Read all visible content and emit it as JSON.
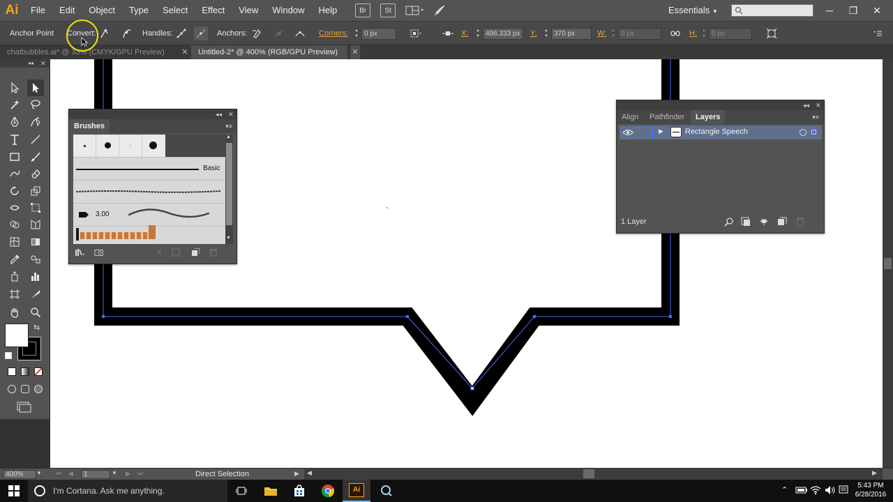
{
  "app": {
    "logo": "Ai"
  },
  "menu": [
    "File",
    "Edit",
    "Object",
    "Type",
    "Select",
    "Effect",
    "View",
    "Window",
    "Help"
  ],
  "menubar_buttons": {
    "bridge": "Br",
    "stock": "St"
  },
  "workspace": {
    "label": "Essentials"
  },
  "window_controls": {
    "minimize": "─",
    "restore": "❐",
    "close": "✕"
  },
  "controlbar": {
    "tool_label": "Anchor Point",
    "convert_label": "Convert:",
    "handles_label": "Handles:",
    "anchors_label": "Anchors:",
    "corners_label": "Corners:",
    "corners_value": "0 px",
    "x_label": "X:",
    "x_value": "496.333 px",
    "y_label": "Y:",
    "y_value": "370 px",
    "w_label": "W:",
    "w_value": "0 px",
    "h_label": "H:",
    "h_value": "0 px"
  },
  "tabs": [
    {
      "label": "chatbubbles.ai* @ 33% (CMYK/GPU Preview)",
      "active": false
    },
    {
      "label": "Untitled-2* @ 400% (RGB/GPU Preview)",
      "active": true
    }
  ],
  "tab_close": "✕",
  "brushes_panel": {
    "title": "Brushes",
    "basic_label": "Basic",
    "size_label": "3.00"
  },
  "layers_panel": {
    "tabs": [
      "Align",
      "Pathfinder",
      "Layers"
    ],
    "active_tab": "Layers",
    "layer_name": "Rectangle Speech",
    "count_label": "1 Layer"
  },
  "panel_controls": {
    "collapse": "◂◂",
    "close": "✕",
    "menu": "▾≡"
  },
  "statusbar": {
    "zoom": "400%",
    "page": "1",
    "tool": "Direct Selection"
  },
  "taskbar": {
    "cortana_placeholder": "I'm Cortana. Ask me anything.",
    "time": "5:43 PM",
    "date": "6/28/2016"
  },
  "colors": {
    "menubar": "#535353",
    "ai_orange": "#f7a21b",
    "path_blue": "#4a6cf0",
    "highlight_yellow": "#f5e000"
  }
}
